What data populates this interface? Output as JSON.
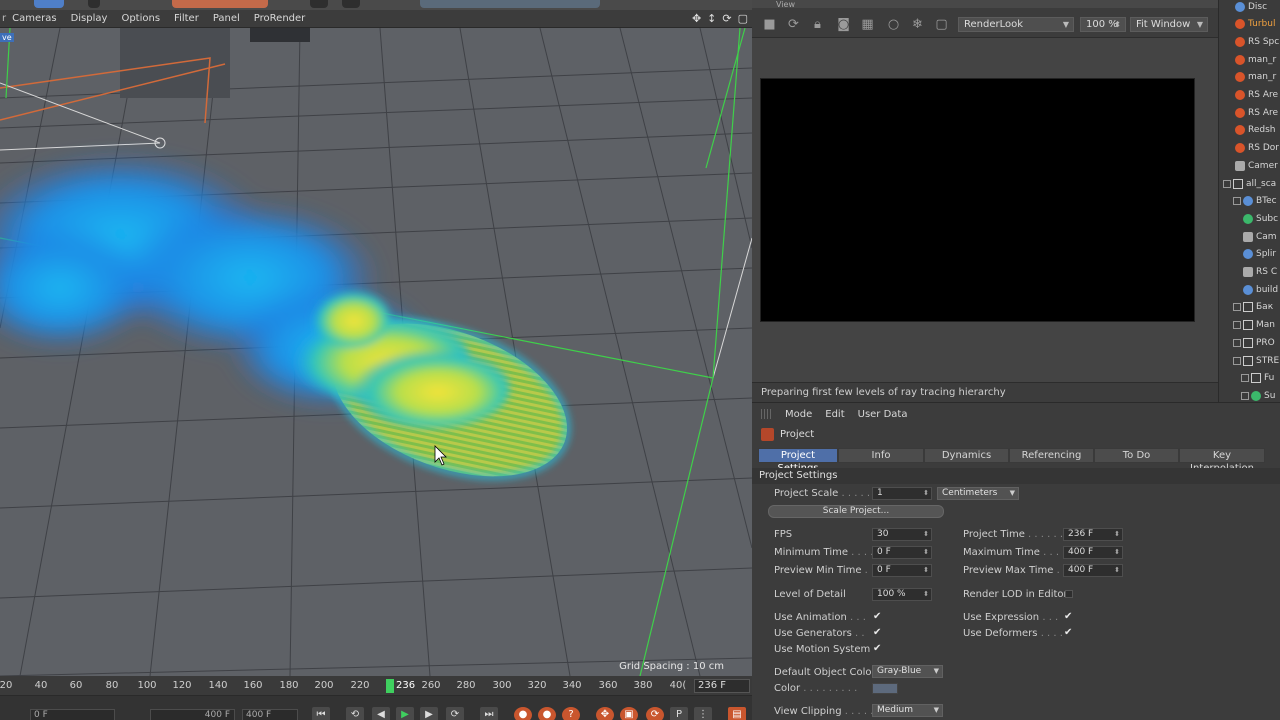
{
  "viewport_menu": [
    "Cameras",
    "Display",
    "Options",
    "Filter",
    "Panel",
    "ProRender"
  ],
  "viewport": {
    "corner_tag": "ve",
    "grid_spacing": "Grid Spacing : 10 cm"
  },
  "timeline": {
    "ticks": [
      "20",
      "40",
      "60",
      "80",
      "100",
      "120",
      "140",
      "160",
      "180",
      "200",
      "220",
      "236",
      "260",
      "280",
      "300",
      "320",
      "340",
      "360",
      "380",
      "40("
    ],
    "current_frame_box": "236 F",
    "start_field": "0 F",
    "end_field_a": "400 F",
    "end_field_b": "400 F"
  },
  "render_view": {
    "title": "View",
    "render_setting": "RenderLook",
    "zoom": "100 %",
    "fit": "Fit Window",
    "status": "Preparing first few levels of ray tracing hierarchy"
  },
  "objects": [
    {
      "label": "Disc",
      "icon": "blu",
      "indent": 16
    },
    {
      "label": "Turbul",
      "icon": "red",
      "indent": 16,
      "selected": true
    },
    {
      "label": "RS Spc",
      "icon": "red",
      "indent": 16
    },
    {
      "label": "man_r",
      "icon": "red",
      "indent": 16
    },
    {
      "label": "man_r",
      "icon": "red",
      "indent": 16
    },
    {
      "label": "RS Are",
      "icon": "red",
      "indent": 16
    },
    {
      "label": "RS Are",
      "icon": "red",
      "indent": 16
    },
    {
      "label": "Redsh",
      "icon": "red",
      "indent": 16
    },
    {
      "label": "RS Dor",
      "icon": "red",
      "indent": 16
    },
    {
      "label": "Camer",
      "icon": "gry",
      "indent": 16
    },
    {
      "label": "all_sca",
      "icon": "nul",
      "indent": 4,
      "expand": true
    },
    {
      "label": "BTec",
      "icon": "blu",
      "indent": 14,
      "expand": true
    },
    {
      "label": "Subc",
      "icon": "grn",
      "indent": 24
    },
    {
      "label": "Cam",
      "icon": "gry",
      "indent": 24
    },
    {
      "label": "Splir",
      "icon": "blu",
      "indent": 24
    },
    {
      "label": "RS C",
      "icon": "gry",
      "indent": 24
    },
    {
      "label": "build",
      "icon": "blu",
      "indent": 24
    },
    {
      "label": "Бак",
      "icon": "nul",
      "indent": 14,
      "expand": true
    },
    {
      "label": "Man",
      "icon": "nul",
      "indent": 14,
      "expand": true
    },
    {
      "label": "PRO",
      "icon": "nul",
      "indent": 14,
      "expand": true
    },
    {
      "label": "STRE",
      "icon": "nul",
      "indent": 14,
      "expand": true
    },
    {
      "label": "Fu",
      "icon": "nul",
      "indent": 22,
      "expand": true
    },
    {
      "label": "Su",
      "icon": "grn",
      "indent": 22,
      "expand": true
    }
  ],
  "attributes": {
    "menu": [
      "Mode",
      "Edit",
      "User Data"
    ],
    "title": "Project",
    "tabs": [
      {
        "label": "Project Settings",
        "active": true
      },
      {
        "label": "Info"
      },
      {
        "label": "Dynamics"
      },
      {
        "label": "Referencing"
      },
      {
        "label": "To Do"
      },
      {
        "label": "Key Interpolation"
      }
    ],
    "section": "Project Settings",
    "project_scale_label": "Project Scale",
    "project_scale_value": "1",
    "project_scale_unit": "Centimeters",
    "scale_button": "Scale Project...",
    "fps_label": "FPS",
    "fps_value": "30",
    "project_time_label": "Project Time",
    "project_time_value": "236 F",
    "min_time_label": "Minimum Time",
    "min_time_value": "0 F",
    "max_time_label": "Maximum Time",
    "max_time_value": "400 F",
    "prev_min_label": "Preview Min Time",
    "prev_min_value": "0 F",
    "prev_max_label": "Preview Max Time",
    "prev_max_value": "400 F",
    "lod_label": "Level of Detail",
    "lod_value": "100 %",
    "render_lod_label": "Render LOD in Editor",
    "use_animation_label": "Use Animation",
    "use_expression_label": "Use Expression",
    "use_generators_label": "Use Generators",
    "use_deformers_label": "Use Deformers",
    "use_motion_label": "Use Motion System",
    "default_color_label": "Default Object Color",
    "default_color_value": "Gray-Blue",
    "color_label": "Color",
    "view_clipping_label": "View Clipping",
    "view_clipping_value": "Medium",
    "check_mark": "✔"
  }
}
